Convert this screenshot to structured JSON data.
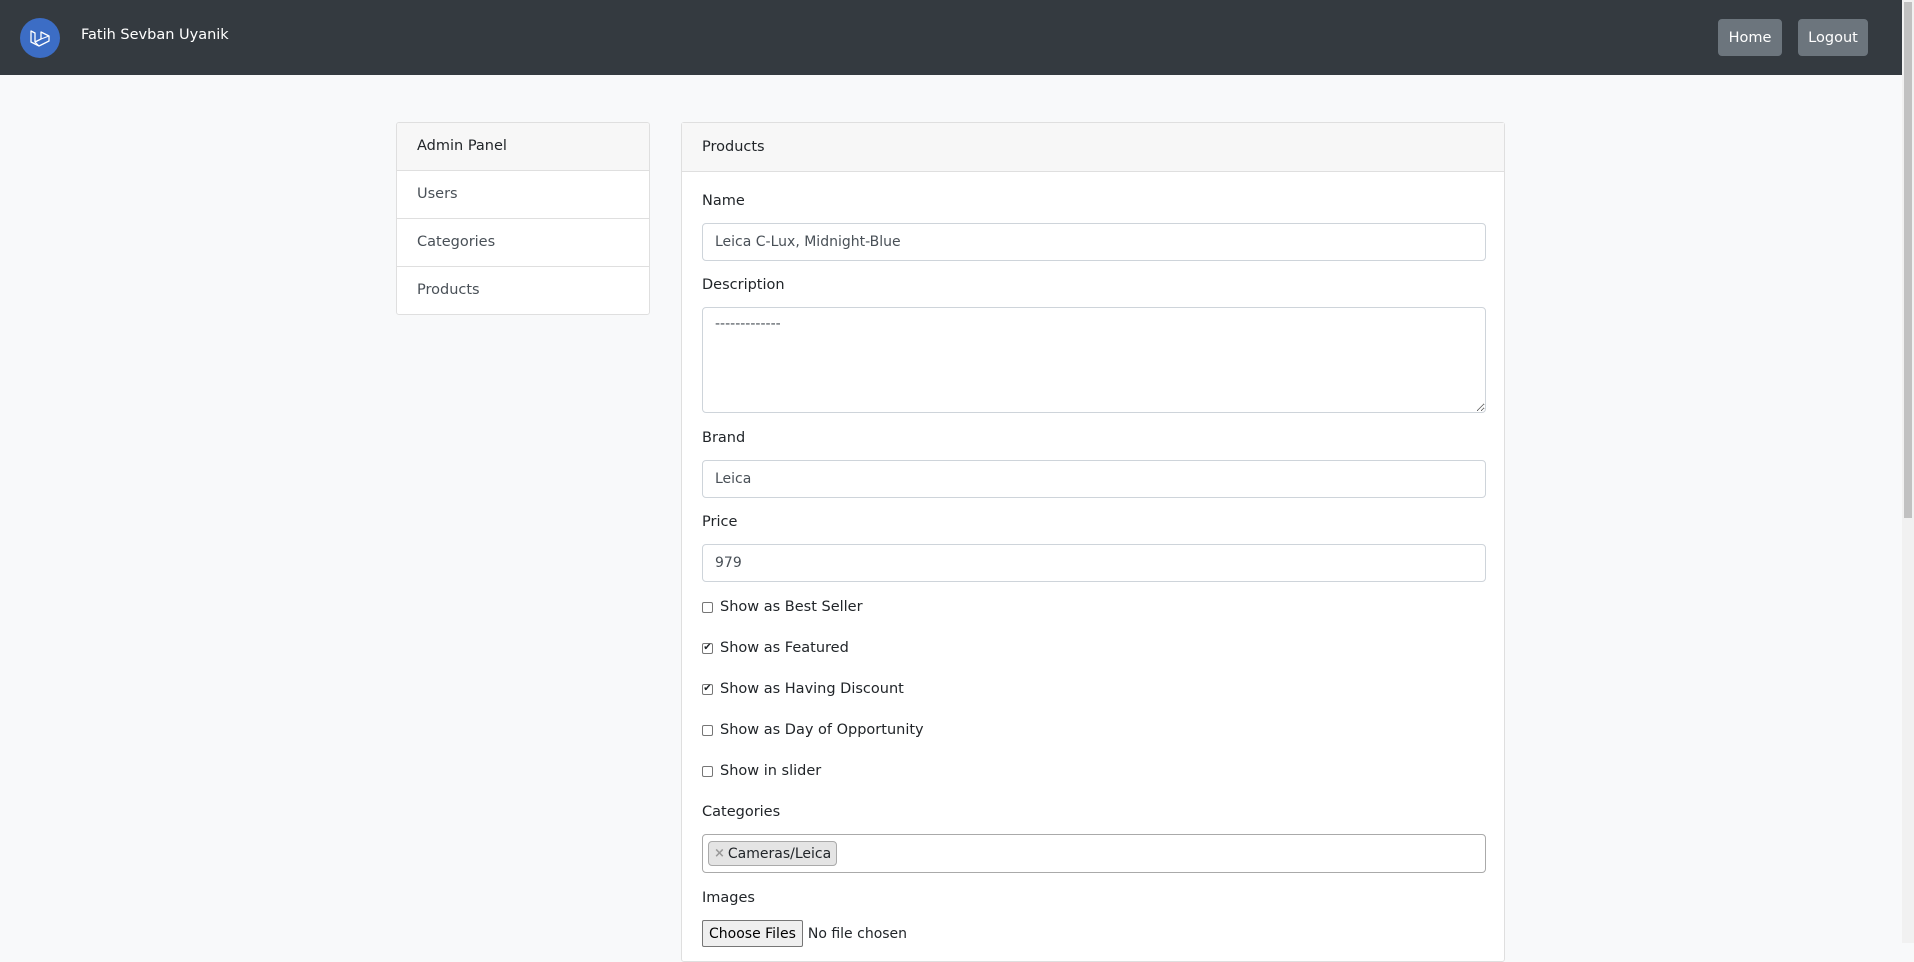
{
  "navbar": {
    "brand_name": "Fatih Sevban Uyanik",
    "logo_icon": "laravel-logo-icon",
    "home_label": "Home",
    "logout_label": "Logout"
  },
  "sidebar": {
    "header": "Admin Panel",
    "items": [
      {
        "label": "Users"
      },
      {
        "label": "Categories"
      },
      {
        "label": "Products"
      }
    ]
  },
  "form": {
    "header": "Products",
    "name_label": "Name",
    "name_value": "Leica C-Lux, Midnight-Blue",
    "description_label": "Description",
    "description_value": "-------------",
    "brand_label": "Brand",
    "brand_value": "Leica",
    "price_label": "Price",
    "price_value": "979",
    "checkboxes": [
      {
        "label": "Show as Best Seller",
        "checked": false
      },
      {
        "label": "Show as Featured",
        "checked": true
      },
      {
        "label": "Show as Having Discount",
        "checked": true
      },
      {
        "label": "Show as Day of Opportunity",
        "checked": false
      },
      {
        "label": "Show in slider",
        "checked": false
      }
    ],
    "categories_label": "Categories",
    "categories_selected": [
      "Cameras/Leica"
    ],
    "images_label": "Images",
    "choose_files_label": "Choose Files",
    "no_file_text": "No file chosen"
  },
  "colors": {
    "navbar_bg": "#343a40",
    "button_bg": "#6c757d",
    "page_bg": "#f8f9fa",
    "logo_bg": "#3c6dc5"
  }
}
